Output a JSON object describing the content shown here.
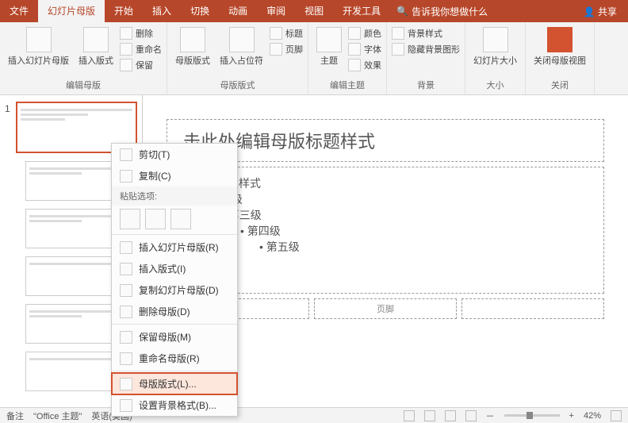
{
  "tabs": {
    "file": "文件",
    "slidemaster": "幻灯片母版",
    "home": "开始",
    "insert": "插入",
    "transition": "切换",
    "animation": "动画",
    "review": "审阅",
    "view": "视图",
    "devtools": "开发工具",
    "tellme": "告诉我你想做什么",
    "share": "共享"
  },
  "ribbon": {
    "editmaster": {
      "label": "编辑母版",
      "insertSlideMaster": "插入幻灯片母版",
      "insertLayout": "插入版式",
      "delete": "删除",
      "rename": "重命名",
      "preserve": "保留"
    },
    "masterlayout": {
      "label": "母版版式",
      "masterLayout": "母版版式",
      "insertPlaceholder": "插入占位符",
      "title": "标题",
      "footer": "页脚"
    },
    "edittheme": {
      "label": "编辑主题",
      "themes": "主题",
      "colors": "颜色",
      "fonts": "字体",
      "effects": "效果"
    },
    "background": {
      "label": "背景",
      "bgstyles": "背景样式",
      "hidebg": "隐藏背景图形"
    },
    "size": {
      "label": "大小",
      "slidesize": "幻灯片大小"
    },
    "close": {
      "label": "关闭",
      "closeMaster": "关闭母版视图"
    }
  },
  "slide": {
    "titlePlaceholder": "击此处编辑母版标题样式",
    "bodyL1": "辑母版文本样式",
    "bodyL2": "第二级",
    "bodyL3": "第三级",
    "bodyL4": "第四级",
    "bodyL5": "第五级",
    "footerCenter": "页脚"
  },
  "thumbs": {
    "num": "1"
  },
  "context": {
    "cut": "剪切(T)",
    "copy": "复制(C)",
    "pasteOptions": "粘贴选项:",
    "insertSlideMaster": "插入幻灯片母版(R)",
    "insertLayout": "插入版式(I)",
    "duplicateSlideMaster": "复制幻灯片母版(D)",
    "deleteMaster": "删除母版(D)",
    "preserveMaster": "保留母版(M)",
    "renameMaster": "重命名母版(R)",
    "masterLayout": "母版版式(L)...",
    "formatBackground": "设置背景格式(B)..."
  },
  "status": {
    "notes": "备注",
    "theme": "\"Office 主题\"",
    "lang": "英语(美国)",
    "zoom": "42%",
    "plus": "+"
  }
}
